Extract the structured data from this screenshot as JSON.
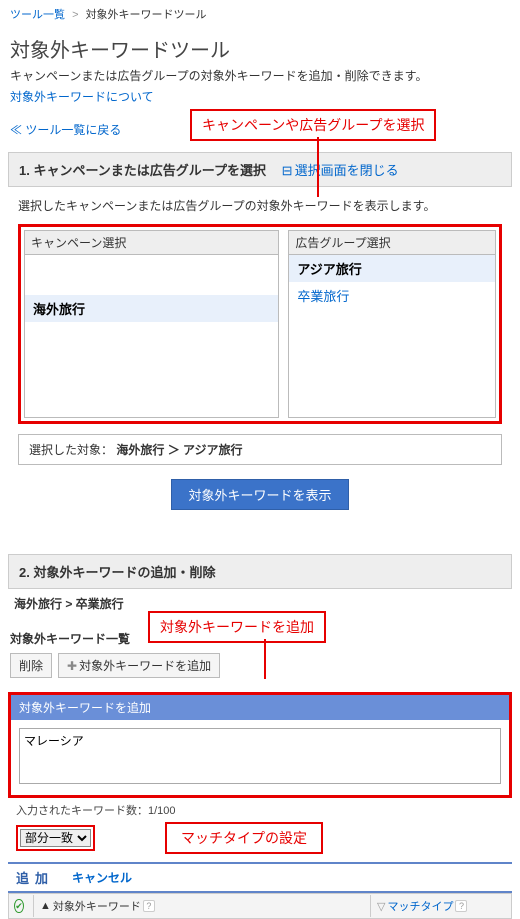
{
  "breadcrumb": {
    "item1": "ツール一覧",
    "item2": "対象外キーワードツール",
    "sep": ">"
  },
  "page": {
    "title": "対象外キーワードツール",
    "desc": "キャンペーンまたは広告グループの対象外キーワードを追加・削除できます。",
    "about": "対象外キーワードについて",
    "back": "ツール一覧に戻る"
  },
  "callouts": {
    "c1": "キャンペーンや広告グループを選択",
    "c2": "対象外キーワードを追加",
    "c3": "マッチタイプの設定"
  },
  "section1": {
    "title": "1. キャンペーンまたは広告グループを選択",
    "toggle": "選択画面を閉じる",
    "desc": "選択したキャンペーンまたは広告グループの対象外キーワードを表示します。",
    "campaign_hdr": "キャンペーン選択",
    "adgroup_hdr": "広告グループ選択",
    "campaigns": [
      "",
      "",
      "",
      "",
      "",
      "海外旅行"
    ],
    "adgroups": [
      "アジア旅行",
      "卒業旅行"
    ],
    "result_label": "選択した対象：",
    "result_value": "海外旅行 ＞ アジア旅行",
    "show_btn": "対象外キーワードを表示"
  },
  "section2": {
    "title": "2. 対象外キーワードの追加・削除",
    "bc": "海外旅行 > 卒業旅行",
    "list_title": "対象外キーワード一覧",
    "delete_btn": "削除",
    "add_btn": "対象外キーワードを追加",
    "panel_hdr": "対象外キーワードを追加",
    "textarea_value": "マレーシア",
    "count": "入力されたキーワード数：1/100",
    "match_select": "部分一致",
    "add_action": "追加",
    "cancel_action": "キャンセル"
  },
  "grid": {
    "col1": "対象外キーワード",
    "col2": "マッチタイプ",
    "sort_sym": "▲",
    "sort_sym2": "▽"
  }
}
